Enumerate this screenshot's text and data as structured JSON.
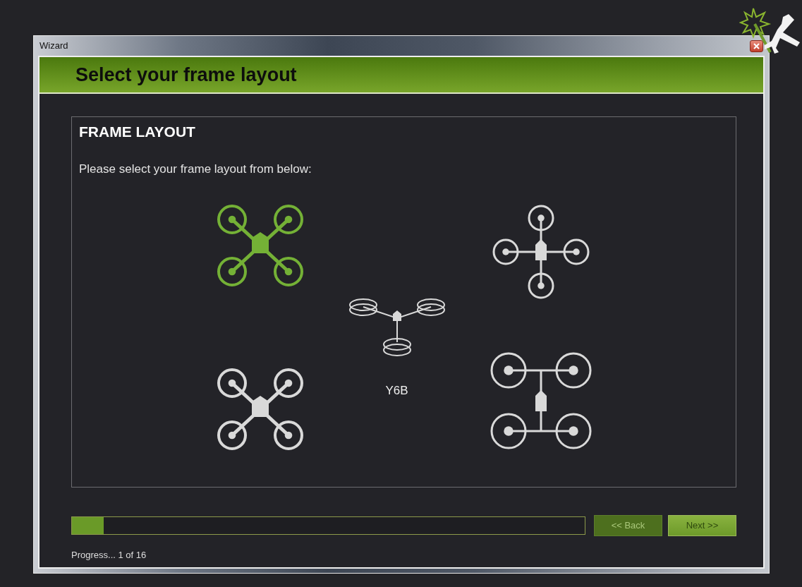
{
  "window": {
    "title": "Wizard"
  },
  "header": {
    "title": "Select your frame layout"
  },
  "panel": {
    "title": "FRAME LAYOUT",
    "instruction": "Please select your frame layout from below:"
  },
  "frames": [
    {
      "kind": "x",
      "selected": true
    },
    {
      "kind": "x",
      "selected": false
    },
    {
      "kind": "y6",
      "selected": false,
      "label": "Y6B"
    },
    {
      "kind": "plus",
      "selected": false
    },
    {
      "kind": "h",
      "selected": false
    }
  ],
  "progress": {
    "level": 0.0625,
    "text": "Progress... 1 of 16"
  },
  "buttons": [
    {
      "label": "<< Back",
      "disabled": true
    },
    {
      "label": "Next >>",
      "disabled": false
    }
  ]
}
